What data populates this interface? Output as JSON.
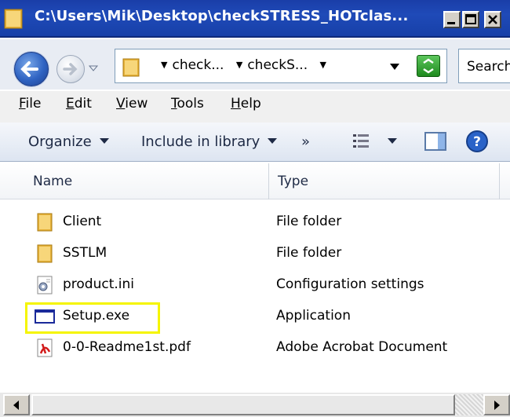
{
  "window": {
    "title": "C:\\Users\\Mik\\Desktop\\checkSTRESS_HOTclas..."
  },
  "address": {
    "crumbs": [
      "check...",
      "checkS..."
    ],
    "search_placeholder": "Search"
  },
  "menu": [
    {
      "label": "File",
      "accel": "F"
    },
    {
      "label": "Edit",
      "accel": "E"
    },
    {
      "label": "View",
      "accel": "V"
    },
    {
      "label": "Tools",
      "accel": "T"
    },
    {
      "label": "Help",
      "accel": "H"
    }
  ],
  "commands": {
    "organize": "Organize",
    "include": "Include in library",
    "more": "»"
  },
  "columns": {
    "name": "Name",
    "type": "Type"
  },
  "files": [
    {
      "name": "Client",
      "type": "File folder",
      "icon": "folder-icon"
    },
    {
      "name": "SSTLM",
      "type": "File folder",
      "icon": "folder-icon"
    },
    {
      "name": "product.ini",
      "type": "Configuration settings",
      "icon": "config-file-icon"
    },
    {
      "name": "Setup.exe",
      "type": "Application",
      "icon": "application-icon"
    },
    {
      "name": "0-0-Readme1st.pdf",
      "type": "Adobe Acrobat Document",
      "icon": "pdf-icon"
    }
  ],
  "colors": {
    "titlebar": "#1f4ab8",
    "highlight": "#f5f500"
  }
}
